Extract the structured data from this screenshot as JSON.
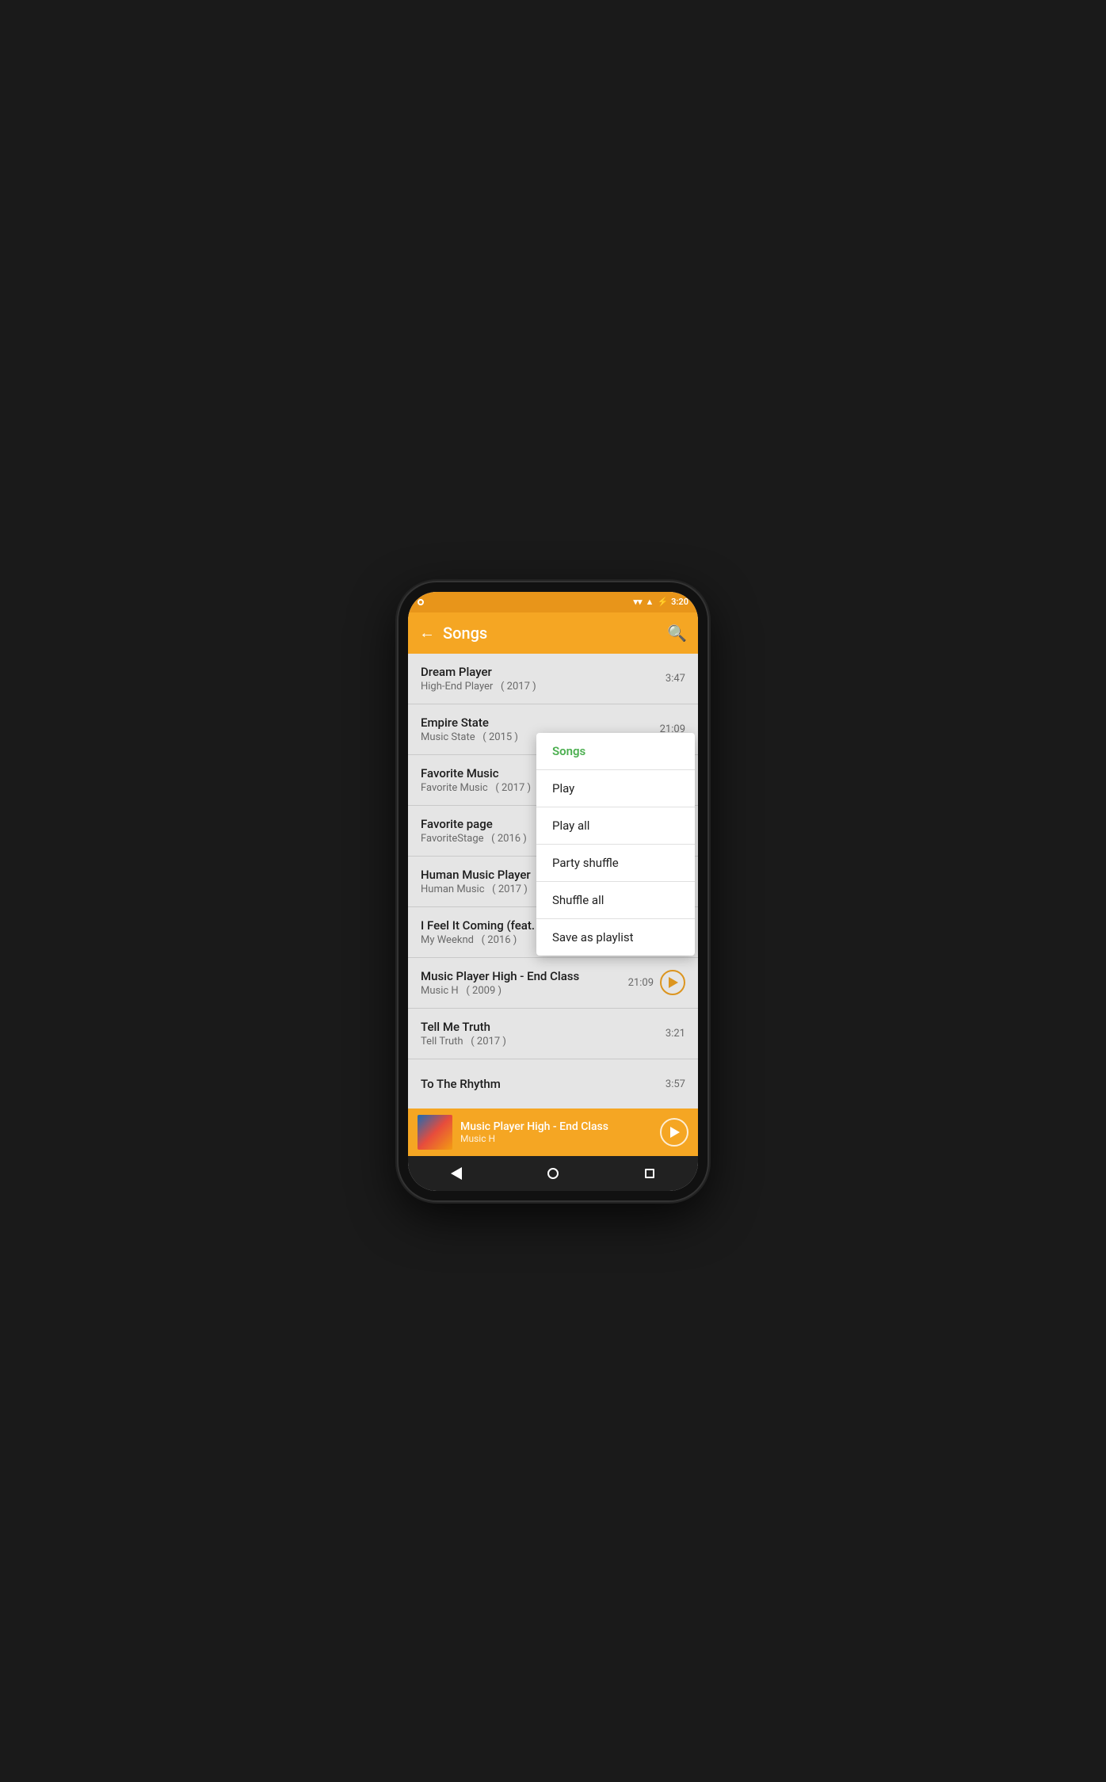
{
  "status": {
    "time": "3:20",
    "wifi": "▼",
    "signal": "▲",
    "battery": "⚡"
  },
  "appBar": {
    "title": "Songs",
    "backLabel": "←",
    "searchLabel": "🔍"
  },
  "songs": [
    {
      "id": 1,
      "title": "Dream Player",
      "artist": "High-End Player",
      "year": "( 2017 )",
      "duration": "3:47",
      "playing": false
    },
    {
      "id": 2,
      "title": "Empire State",
      "artist": "Music State",
      "year": "( 2015 )",
      "duration": "21:09",
      "playing": false
    },
    {
      "id": 3,
      "title": "Favorite Music",
      "artist": "Favorite Music",
      "year": "( 2017 )",
      "duration": "",
      "playing": false
    },
    {
      "id": 4,
      "title": "Favorite page",
      "artist": "FavoriteStage",
      "year": "( 2016 )",
      "duration": "",
      "playing": false
    },
    {
      "id": 5,
      "title": "Human Music Player",
      "artist": "Human Music",
      "year": "( 2017 )",
      "duration": "",
      "playing": false
    },
    {
      "id": 6,
      "title": "I Feel It Coming (feat. Mus…",
      "artist": "My Weeknd",
      "year": "( 2016 )",
      "duration": "",
      "playing": false
    },
    {
      "id": 7,
      "title": "Music Player High - End Class",
      "artist": "Music H",
      "year": "( 2009 )",
      "duration": "21:09",
      "playing": true
    },
    {
      "id": 8,
      "title": "Tell Me Truth",
      "artist": "Tell Truth",
      "year": "( 2017 )",
      "duration": "3:21",
      "playing": false
    },
    {
      "id": 9,
      "title": "To The Rhythm",
      "artist": "",
      "year": "",
      "duration": "3:57",
      "playing": false
    }
  ],
  "contextMenu": {
    "header": "Songs",
    "items": [
      {
        "id": "play",
        "label": "Play"
      },
      {
        "id": "play-all",
        "label": "Play all"
      },
      {
        "id": "party-shuffle",
        "label": "Party shuffle"
      },
      {
        "id": "shuffle-all",
        "label": "Shuffle all"
      },
      {
        "id": "save-playlist",
        "label": "Save as playlist"
      }
    ]
  },
  "nowPlaying": {
    "title": "Music Player High - End Class",
    "artist": "Music H"
  },
  "colors": {
    "accent": "#f5a623",
    "green": "#4CAF50",
    "darkText": "#212121",
    "grayText": "#757575"
  }
}
